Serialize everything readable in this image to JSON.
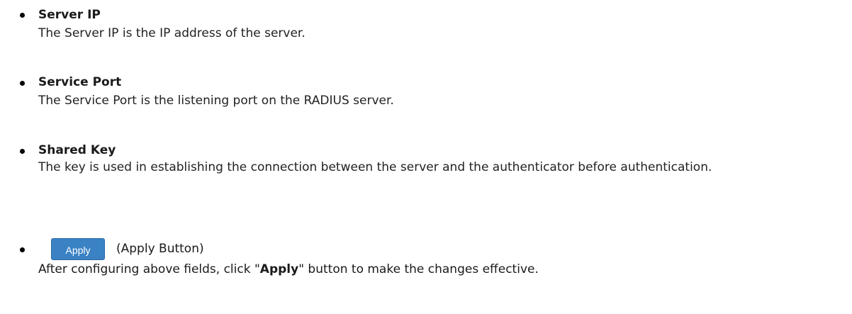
{
  "items": [
    {
      "term": "Server IP",
      "description": "The Server IP is the IP address of the server."
    },
    {
      "term": "Service Port",
      "description": "The Service Port is the listening port on the RADIUS server."
    },
    {
      "term": "Shared Key",
      "description": "The key is used in establishing the connection between the server and the authenticator before authentication."
    }
  ],
  "apply": {
    "button_label": "Apply",
    "caption": "(Apply Button)",
    "desc_prefix": "After configuring above fields, click \"",
    "desc_bold": "Apply",
    "desc_suffix": "\" button to make the changes effective.",
    "button_color": "#3a82c4"
  }
}
